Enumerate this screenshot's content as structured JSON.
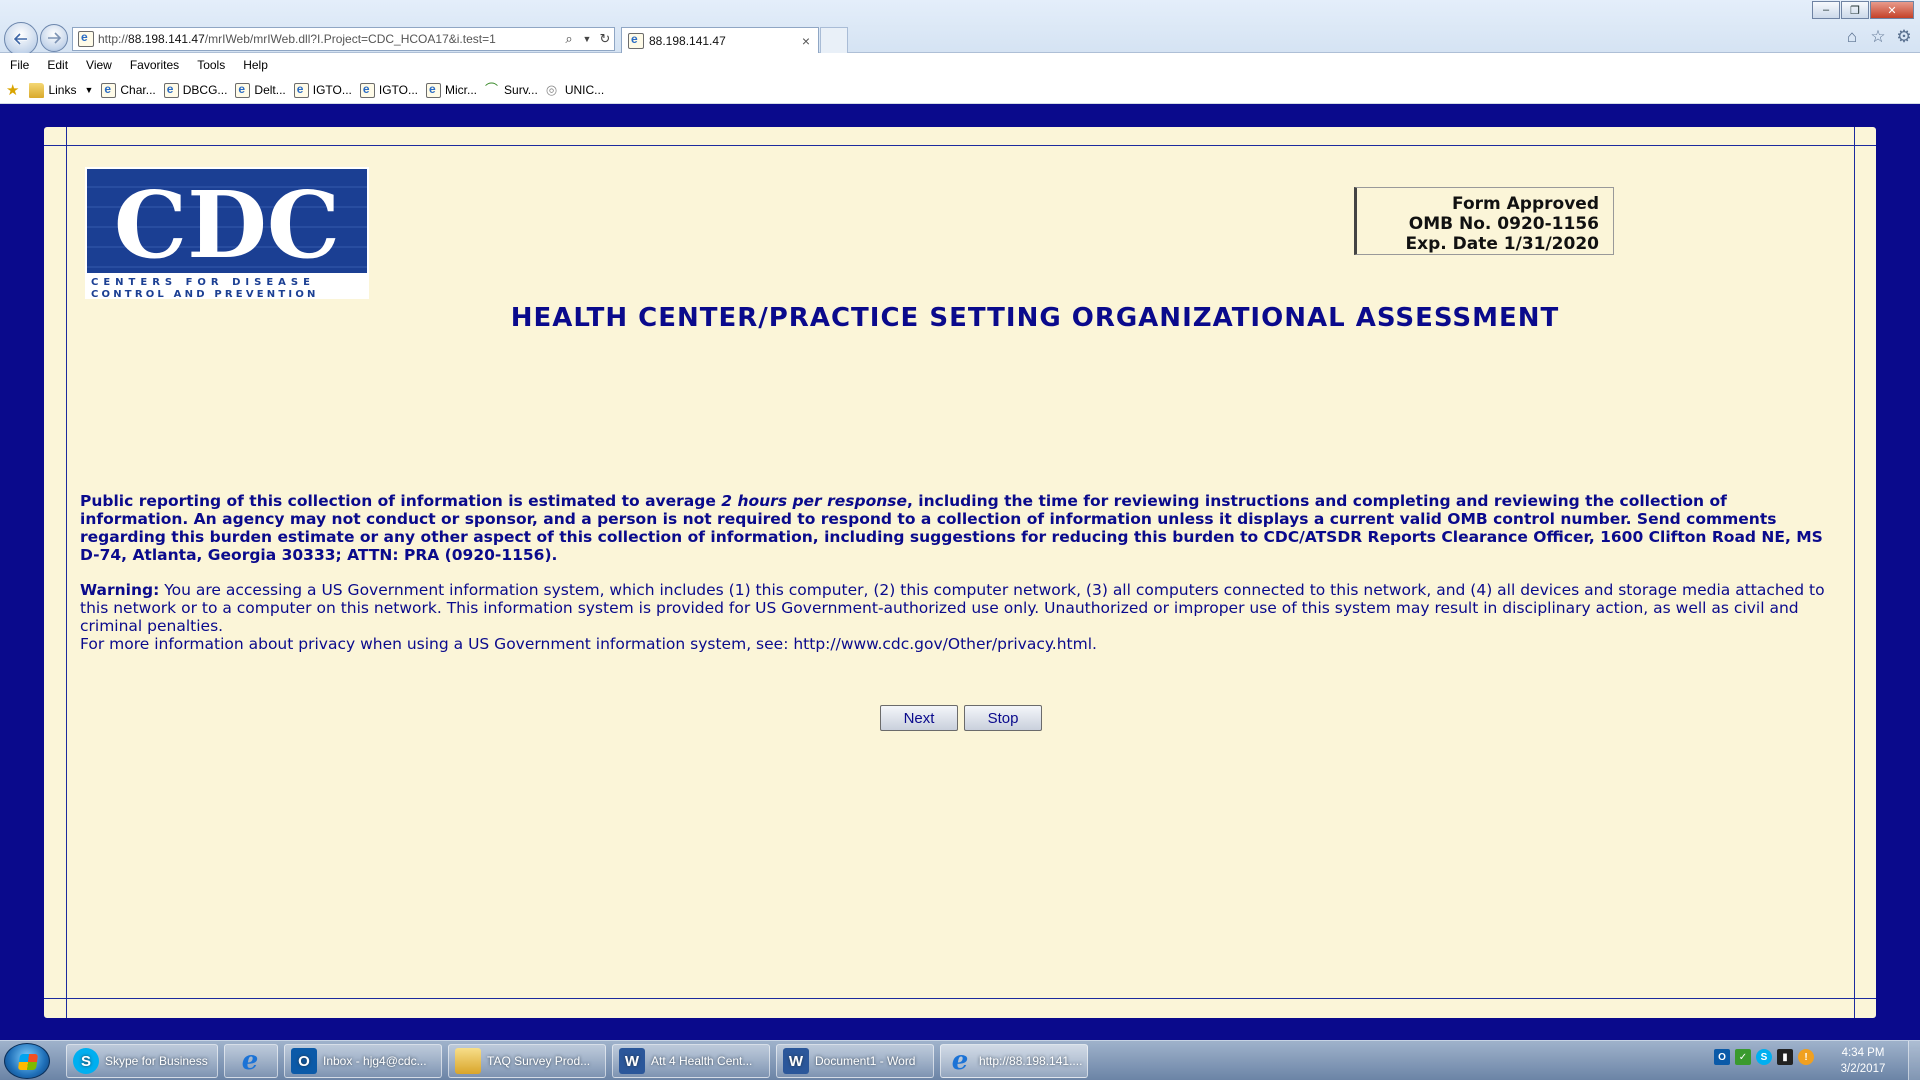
{
  "browser": {
    "address": {
      "prefix": "http://",
      "host": "88.198.141.47",
      "path": "/mrIWeb/mrIWeb.dll?I.Project=CDC_HCOA17&i.test=1"
    },
    "tab_title": "88.198.141.47",
    "tab_close": "×",
    "window_buttons": {
      "minimize": "–",
      "restore": "❐",
      "close": "✕"
    },
    "menu": [
      "File",
      "Edit",
      "View",
      "Favorites",
      "Tools",
      "Help"
    ],
    "favorites": [
      {
        "label": "Links",
        "icon": "folder-icon"
      },
      {
        "label": "Char...",
        "icon": "page-icon"
      },
      {
        "label": "DBCG...",
        "icon": "page-icon"
      },
      {
        "label": "Delt...",
        "icon": "page-icon"
      },
      {
        "label": "IGTO...",
        "icon": "page-icon"
      },
      {
        "label": "IGTO...",
        "icon": "page-icon"
      },
      {
        "label": "Micr...",
        "icon": "page-icon"
      },
      {
        "label": "Surv...",
        "icon": "survey-icon"
      },
      {
        "label": "UNIC...",
        "icon": "globe-icon"
      }
    ]
  },
  "page": {
    "logo_text": "CDC",
    "logo_subtext_1": "CENTERS FOR DISEASE",
    "logo_subtext_2": "CONTROL AND PREVENTION",
    "form_approved": {
      "line1": "Form Approved",
      "line2": "OMB No. 0920-1156",
      "line3": "Exp. Date 1/31/2020"
    },
    "title": "HEALTH CENTER/PRACTICE SETTING ORGANIZATIONAL ASSESSMENT",
    "burden": {
      "before": "Public reporting of this collection of information is estimated to average ",
      "emphasis": "2 hours per response",
      "after": ", including the time for reviewing instructions and completing and reviewing the collection of information. An agency may not conduct or sponsor, and a person is not required to respond to a collection of information unless it displays a current valid OMB control number. Send comments regarding this burden estimate or any other aspect of this collection of information, including suggestions for reducing this burden to CDC/ATSDR Reports Clearance Officer, 1600 Clifton Road NE, MS D-74, Atlanta, Georgia 30333; ATTN: PRA (0920-1156)."
    },
    "warning": {
      "label": "Warning:",
      "text": " You are accessing a US Government information system, which includes (1) this computer, (2) this computer network, (3) all computers connected to this network, and (4) all devices and storage media attached to this network or to a computer on this network. This information system is provided for US Government-authorized use only. Unauthorized or improper use of this system may result in disciplinary action, as well as civil and criminal penalties."
    },
    "privacy": "For more information about privacy when using a US Government information system, see: http://www.cdc.gov/Other/privacy.html.",
    "buttons": {
      "next": "Next",
      "stop": "Stop"
    }
  },
  "taskbar": {
    "items": [
      {
        "label": "Skype for Business",
        "icon": "skype-icon"
      },
      {
        "label": "",
        "icon": "ie-icon"
      },
      {
        "label": "Inbox - hjg4@cdc...",
        "icon": "outlook-icon"
      },
      {
        "label": "TAQ Survey Prod...",
        "icon": "folder-icon"
      },
      {
        "label": "Att 4 Health Cent...",
        "icon": "word-icon"
      },
      {
        "label": "Document1 - Word",
        "icon": "word-icon"
      },
      {
        "label": "http://88.198.141....",
        "icon": "ie-icon"
      }
    ],
    "clock_time": "4:34 PM",
    "clock_date": "3/2/2017"
  },
  "colors": {
    "page_background": "#0a0a8c",
    "panel": "#fbf5d8",
    "text": "#0a0a8c"
  }
}
